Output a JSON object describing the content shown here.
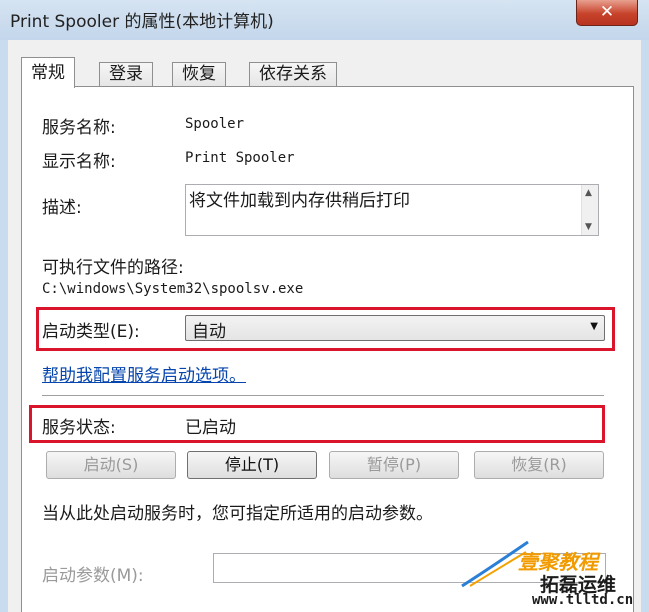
{
  "window": {
    "title": "Print Spooler 的属性(本地计算机)",
    "close_label": "✕"
  },
  "tabs": [
    {
      "label": "常规",
      "active": true
    },
    {
      "label": "登录",
      "active": false
    },
    {
      "label": "恢复",
      "active": false
    },
    {
      "label": "依存关系",
      "active": false
    }
  ],
  "general": {
    "service_name_label": "服务名称:",
    "service_name_value": "Spooler",
    "display_name_label": "显示名称:",
    "display_name_value": "Print Spooler",
    "description_label": "描述:",
    "description_value": "将文件加载到内存供稍后打印",
    "path_label": "可执行文件的路径:",
    "path_value": "C:\\windows\\System32\\spoolsv.exe",
    "startup_type_label": "启动类型(E):",
    "startup_type_value": "自动",
    "help_link": "帮助我配置服务启动选项。",
    "status_label": "服务状态:",
    "status_value": "已启动",
    "buttons": {
      "start": "启动(S)",
      "stop": "停止(T)",
      "pause": "暂停(P)",
      "resume": "恢复(R)"
    },
    "hint_text": "当从此处启动服务时，您可指定所适用的启动参数。",
    "start_params_label": "启动参数(M):",
    "start_params_value": ""
  },
  "watermark": {
    "line1": "壹聚教程",
    "line2": "拓磊运维",
    "url": "www.tlltd.cn"
  },
  "colors": {
    "highlight_frame": "#d9142b",
    "link": "#0645ad",
    "close_button": "#c7432b"
  }
}
